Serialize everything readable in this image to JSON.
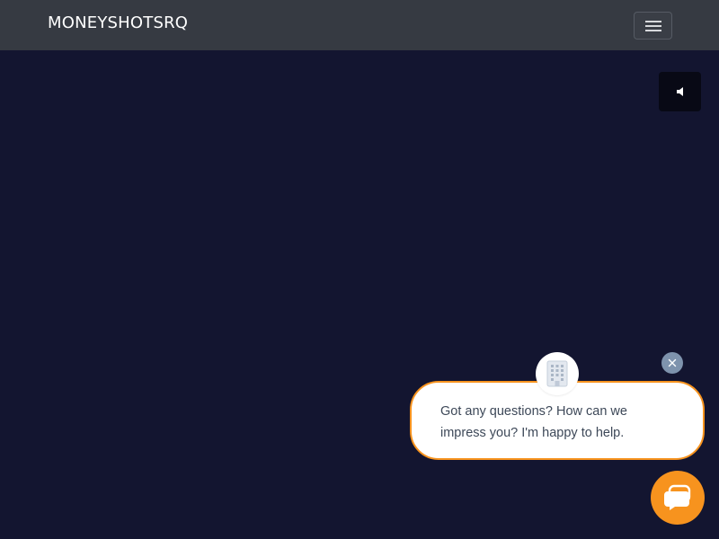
{
  "navbar": {
    "brand": "MONEYSHOTSRQ",
    "menu_icon": "hamburger-icon"
  },
  "hero": {
    "background": "#131530",
    "sound_icon": "speaker-icon"
  },
  "chat": {
    "message": "Got any questions? How can we impress you? I'm happy to help.",
    "avatar_icon": "building-icon",
    "close_icon": "close-icon",
    "launcher_icon": "chat-bubbles-icon",
    "accent": "#f7931e",
    "close_color": "#7e93ad"
  }
}
